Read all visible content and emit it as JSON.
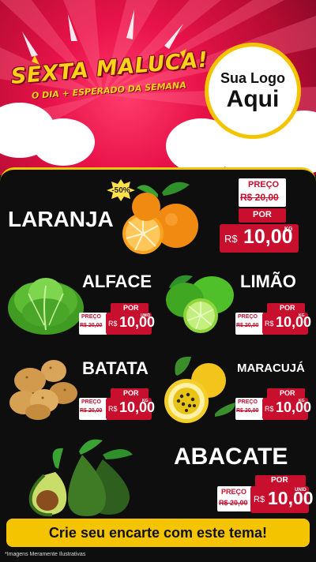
{
  "header": {
    "title": "SEXTA MALUCA!",
    "subtitle": "O DIA + ESPERADO DA SEMANA",
    "logo_line1": "Sua Logo",
    "logo_line2": "Aqui"
  },
  "products": {
    "laranja": {
      "name": "LARANJA",
      "discount": "-50%",
      "preco_label": "PREÇO",
      "old_price": "R$ 20,00",
      "por_label": "POR",
      "currency": "R$",
      "price": "10,00",
      "unit": "KG"
    },
    "alface": {
      "name": "ALFACE",
      "preco_label": "PREÇO",
      "old_price": "R$ 20,00",
      "por_label": "POR",
      "currency": "R$",
      "price": "10,00",
      "unit": "UNID"
    },
    "limao": {
      "name": "LIMÃO",
      "preco_label": "PREÇO",
      "old_price": "R$ 20,00",
      "por_label": "POR",
      "currency": "R$",
      "price": "10,00",
      "unit": "KG"
    },
    "batata": {
      "name": "BATATA",
      "preco_label": "PREÇO",
      "old_price": "R$ 20,00",
      "por_label": "POR",
      "currency": "R$",
      "price": "10,00",
      "unit": "KG"
    },
    "maracuja": {
      "name": "MARACUJÁ",
      "preco_label": "PREÇO",
      "old_price": "R$ 20,00",
      "por_label": "POR",
      "currency": "R$",
      "price": "10,00",
      "unit": "KG"
    },
    "abacate": {
      "name": "ABACATE",
      "preco_label": "PREÇO",
      "old_price": "R$ 20,00",
      "por_label": "POR",
      "currency": "R$",
      "price": "10,00",
      "unit": "UNID"
    }
  },
  "cta": "Crie seu encarte com este tema!",
  "footnote": "*Imagens Meramente Ilustrativas",
  "colors": {
    "accent_yellow": "#f5c400",
    "price_red": "#c8102e",
    "header_pink": "#e8134a"
  }
}
